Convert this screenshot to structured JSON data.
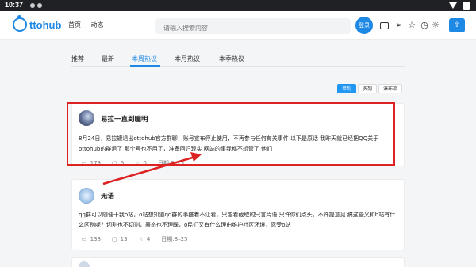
{
  "status_bar": {
    "time": "10:37"
  },
  "header": {
    "logo_text": "ttohub",
    "nav": [
      "首页",
      "动态"
    ],
    "search_placeholder": "请输入搜索内容",
    "login_label": "登录",
    "icons": [
      "mail-icon",
      "send-icon",
      "star-icon",
      "history-icon",
      "bulb-icon",
      "upload-icon"
    ]
  },
  "tabs": {
    "items": [
      "推荐",
      "最新",
      "本周热议",
      "本月热议",
      "本季热议"
    ],
    "active": "本周热议"
  },
  "views": {
    "items": [
      "单列",
      "多列",
      "瀑布流"
    ],
    "active": "单列"
  },
  "posts": [
    {
      "author": "易拉一直到瞳明",
      "content": "8月24日，易拉罐退出ottohub官方群聊，账号宣布停止使用，不再参与任何有关事件 以下是原话 我昨天就已经把QQ关于ottohub的群退了 那个号也不用了，准备回归现实 网站的事我都不想管了 他们",
      "views": "179",
      "comments": "6",
      "likes": "0",
      "date": "日期:8–25"
    },
    {
      "author": "无语",
      "content": "qq群可以随便干我o站，o站想知道qq群的事搭着不让看，只能看截取的只言片语 只许你们点头，不许提意见 搞这些又和b站有什么区别呢？切割也不切割，表态也不理睬，o民们又有什么理由维护社区环境，忍受o站",
      "views": "138",
      "comments": "13",
      "likes": "4",
      "date": "日期:8–25"
    }
  ],
  "colors": {
    "accent": "#1e88e5",
    "annotation": "#dd2222"
  }
}
